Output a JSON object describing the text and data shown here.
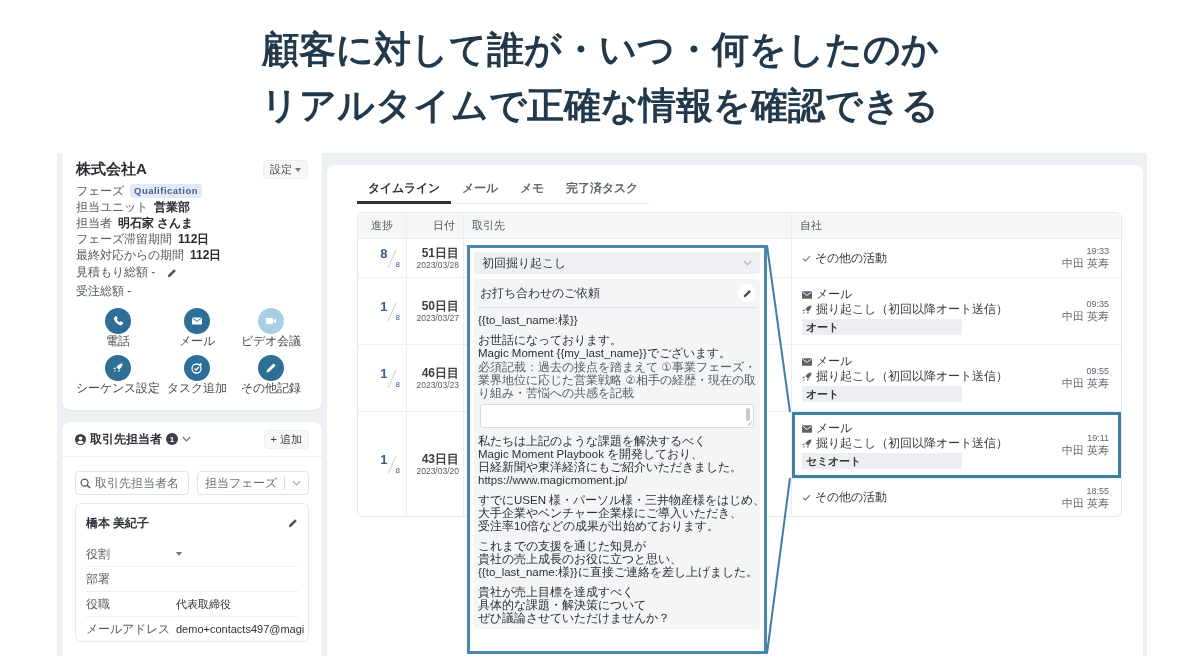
{
  "headline": {
    "lines": [
      "顧客に対して誰が・いつ・何をしたのか",
      "リアルタイムで正確な情報を確認できる"
    ]
  },
  "account": {
    "company": "株式会社A",
    "settings_button": "設定",
    "phase_label": "フェーズ",
    "phase": "Qualification",
    "details": [
      {
        "label": "担当ユニット",
        "value": "営業部"
      },
      {
        "label": "担当者",
        "value": "明石家 さんま"
      },
      {
        "label": "フェーズ滞留期間",
        "value": "112日"
      },
      {
        "label": "最終対応からの期間",
        "value": "112日"
      }
    ],
    "amounts": [
      {
        "text": "見積もり総額 -",
        "editable": true
      },
      {
        "text": "受注総額 -",
        "editable": false
      }
    ],
    "actions": [
      {
        "kind": "phone",
        "label": "電話",
        "disabled": false
      },
      {
        "kind": "mail",
        "label": "メール",
        "disabled": false
      },
      {
        "kind": "video",
        "label": "ビデオ会議",
        "disabled": true
      },
      {
        "kind": "rocket",
        "label": "シーケンス設定",
        "disabled": false
      },
      {
        "kind": "task",
        "label": "タスク追加",
        "disabled": false
      },
      {
        "kind": "pencil",
        "label": "その他記録",
        "disabled": false
      }
    ]
  },
  "contacts": {
    "title": "取引先担当者",
    "count": "1",
    "add_button": "+ 追加",
    "search": {
      "placeholder": "取引先担当者名"
    },
    "phase_filter": {
      "placeholder": "担当フェーズ"
    },
    "contact": {
      "name": "橋本 美紀子",
      "fields": [
        {
          "label": "役割",
          "kind": "select"
        },
        {
          "label": "部署",
          "kind": "text"
        },
        {
          "label": "役職",
          "kind": "text",
          "value": "代表取締役"
        },
        {
          "label": "メールアドレス",
          "kind": "text",
          "value": "demo+contacts497@magi"
        }
      ]
    }
  },
  "timeline": {
    "tabs": [
      {
        "label": "タイムライン",
        "selected": true
      },
      {
        "label": "メール",
        "selected": false
      },
      {
        "label": "メモ",
        "selected": false
      },
      {
        "label": "完了済タスク",
        "selected": false
      }
    ],
    "columns": [
      "進捗",
      "日付",
      "取引先",
      "自社"
    ],
    "rows": [
      {
        "progress": "8",
        "total": "8",
        "day": "51日目",
        "date": "2023/03/28",
        "activities": [
          {
            "kind": "other",
            "title": "その他の活動",
            "time": "19:33",
            "person": "中田 英寿",
            "highlighted": false
          }
        ]
      },
      {
        "progress": "1",
        "total": "8",
        "day": "50日目",
        "date": "2023/03/27",
        "activities": [
          {
            "kind": "mail",
            "title": "メール",
            "sequence": "掘り起こし（初回以降オート送信）",
            "mode": "オート",
            "time": "09:35",
            "person": "中田 英寿",
            "highlighted": false
          }
        ]
      },
      {
        "progress": "1",
        "total": "8",
        "day": "46日目",
        "date": "2023/03/23",
        "activities": [
          {
            "kind": "mail",
            "title": "メール",
            "sequence": "掘り起こし（初回以降オート送信）",
            "mode": "オート",
            "time": "09:55",
            "person": "中田 英寿",
            "highlighted": false
          }
        ]
      },
      {
        "progress": "1",
        "total": "8",
        "day": "43日目",
        "date": "2023/03/20",
        "activities": [
          {
            "kind": "mail",
            "title": "メール",
            "sequence": "掘り起こし（初回以降オート送信）",
            "mode": "セミオート",
            "time": "19:11",
            "person": "中田 英寿",
            "highlighted": true
          },
          {
            "kind": "other",
            "title": "その他の活動",
            "time": "18:55",
            "person": "中田 英寿",
            "highlighted": false
          }
        ]
      }
    ]
  },
  "email_callout": {
    "sequence": "初回掘り起こし",
    "subject": "お打ち合わせのご依頼",
    "blocks": [
      {
        "kind": "text",
        "lines": [
          "{{to_last_name:様}}"
        ]
      },
      {
        "kind": "text",
        "lines": [
          "お世話になっております。",
          "Magic Moment {{my_last_name}}でございます。"
        ]
      },
      {
        "kind": "note",
        "text": "必須記載：過去の接点を踏まえて ①事業フェーズ・業界地位に応じた営業戦略 ②相手の経歴・現在の取り組み・苦悩への共感を記載"
      },
      {
        "kind": "field"
      },
      {
        "kind": "text",
        "lines": [
          "私たちは上記のような課題を解決するべく",
          "Magic Moment Playbook を開発しており、",
          "日経新聞や東洋経済にもご紹介いただきました。",
          "https://www.magicmoment.jp/"
        ]
      },
      {
        "kind": "text",
        "lines": [
          "すでにUSEN 様・パーソル様・三井物産様をはじめ、",
          "大手企業やベンチャー企業様にご導入いただき、",
          "受注率10倍などの成果が出始めております。"
        ]
      },
      {
        "kind": "text",
        "lines": [
          "これまでの支援を通じた知見が",
          "貴社の売上成長のお役に立つと思い、",
          "{{to_last_name:様}}に直接ご連絡を差し上げました。"
        ]
      },
      {
        "kind": "text",
        "lines": [
          "貴社が売上目標を達成すべく",
          "具体的な課題・解決策について",
          "ぜひ議論させていただけませんか？"
        ]
      }
    ]
  }
}
